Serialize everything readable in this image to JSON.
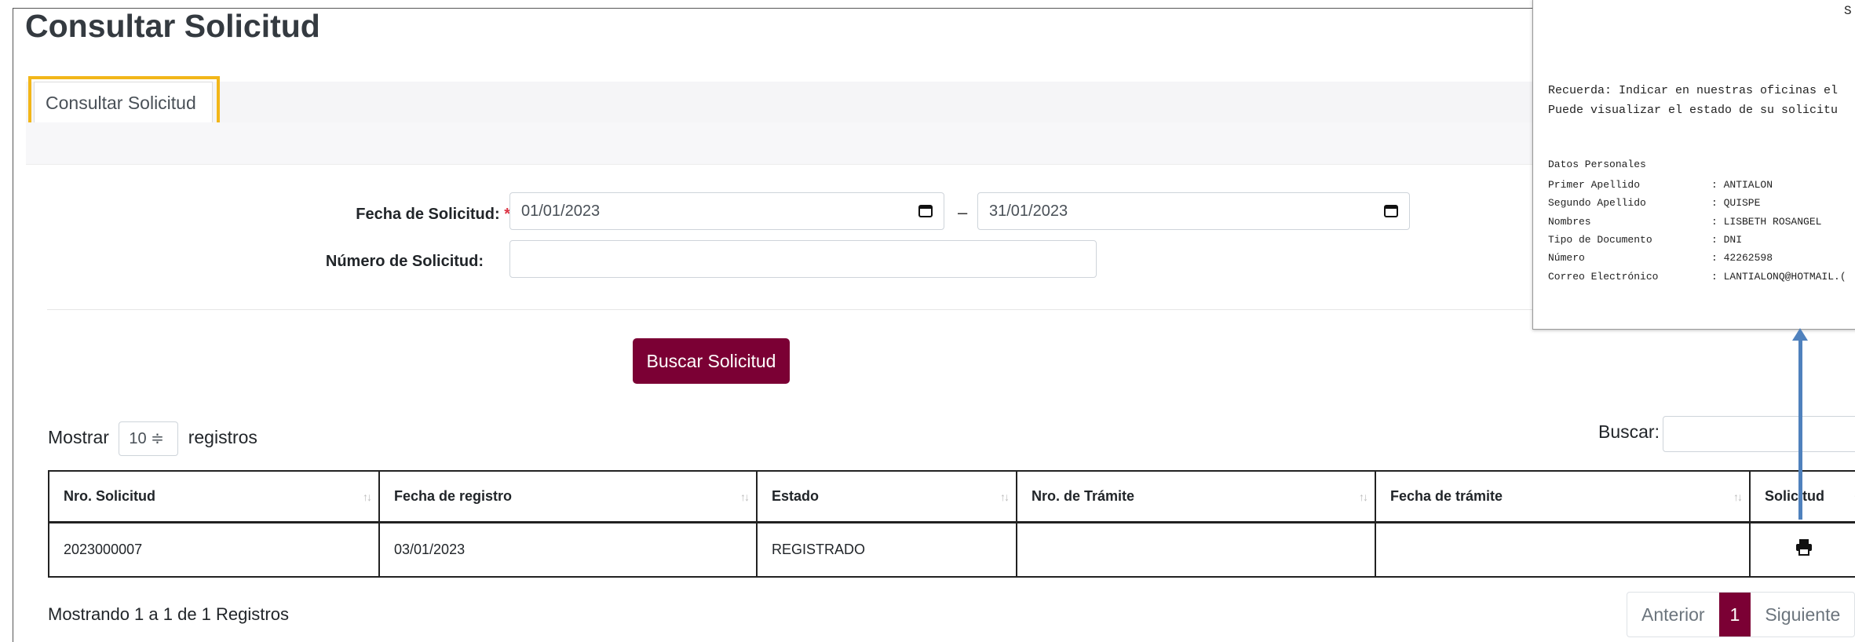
{
  "page": {
    "title": "Consultar Solicitud",
    "tab_label": "Consultar Solicitud"
  },
  "form": {
    "fecha_label": "Fecha de Solicitud:",
    "required_mark": "*",
    "date_from": "01/01/2023",
    "date_separator": "–",
    "date_to": "31/01/2023",
    "numero_label": "Número de Solicitud:",
    "numero_value": "",
    "search_button": "Buscar Solicitud"
  },
  "table_controls": {
    "show_prefix": "Mostrar",
    "page_size": "10 ≑",
    "show_suffix": "registros",
    "search_label": "Buscar:"
  },
  "table": {
    "headers": [
      "Nro. Solicitud",
      "Fecha de registro",
      "Estado",
      "Nro. de Trámite",
      "Fecha de trámite",
      "Solicitud"
    ],
    "sort_glyph": "↑↓",
    "rows": [
      [
        "2023000007",
        "03/01/2023",
        "REGISTRADO",
        "",
        "",
        ""
      ]
    ]
  },
  "footer": {
    "info": "Mostrando 1 a 1 de 1 Registros",
    "prev": "Anterior",
    "current": "1",
    "next": "Siguiente"
  },
  "document_preview": {
    "corner": "S",
    "notes": [
      "Recuerda: Indicar en nuestras oficinas el",
      "Puede visualizar el estado de su solicitu"
    ],
    "section_title": "Datos Personales",
    "fields": [
      {
        "label": "Primer Apellido",
        "value": ": ANTIALON"
      },
      {
        "label": "Segundo Apellido",
        "value": ": QUISPE"
      },
      {
        "label": "Nombres",
        "value": ": LISBETH ROSANGEL"
      },
      {
        "label": "Tipo de Documento",
        "value": ": DNI"
      },
      {
        "label": "Número",
        "value": ": 42262598"
      },
      {
        "label": "Correo Electrónico",
        "value": ": LANTIALONQ@HOTMAIL.("
      }
    ]
  },
  "colors": {
    "brand": "#7b0034",
    "highlight": "#f2b619",
    "arrow": "#4f81bd"
  }
}
